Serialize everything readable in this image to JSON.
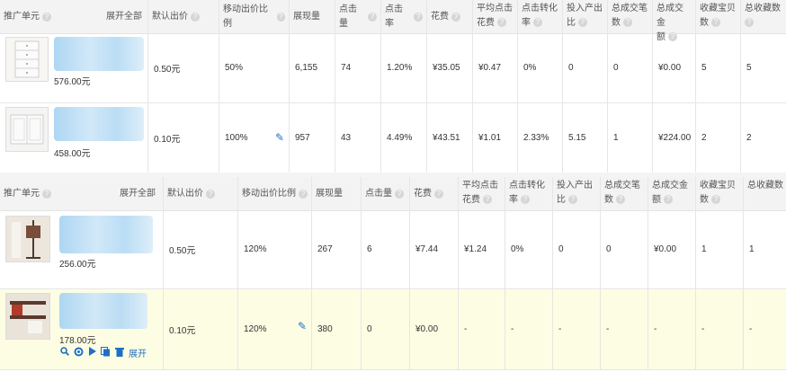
{
  "table1": {
    "headers": {
      "unit": "推广单元",
      "expand": "展开全部",
      "bid": "默认出价",
      "mobile_ratio": "移动出价比例",
      "impressions": "展现量",
      "clicks": "点击量",
      "ctr": "点击率",
      "cost": "花费",
      "avg_cpc_1": "平均点击",
      "avg_cpc_2": "花费",
      "conv_1": "点击转化",
      "conv_2": "率",
      "roi_1": "投入产出",
      "roi_2": "比",
      "orders_1": "总成交笔",
      "orders_2": "数",
      "amount_1": "总成交金",
      "amount_2": "额",
      "fav_items_1": "收藏宝贝",
      "fav_items_2": "数",
      "fav_shop_1": "总收藏数"
    },
    "rows": [
      {
        "price": "576.00元",
        "bid": "0.50元",
        "mobile_ratio": "50%",
        "impressions": "6,155",
        "clicks": "74",
        "ctr": "1.20%",
        "cost": "¥35.05",
        "avg_cpc": "¥0.47",
        "conv": "0%",
        "roi": "0",
        "orders": "0",
        "amount": "¥0.00",
        "fav_items": "5",
        "fav_total": "5"
      },
      {
        "price": "458.00元",
        "bid": "0.10元",
        "mobile_ratio": "100%",
        "impressions": "957",
        "clicks": "43",
        "ctr": "4.49%",
        "cost": "¥43.51",
        "avg_cpc": "¥1.01",
        "conv": "2.33%",
        "roi": "5.15",
        "orders": "1",
        "amount": "¥224.00",
        "fav_items": "2",
        "fav_total": "2"
      }
    ]
  },
  "table2": {
    "headers": {
      "unit": "推广单元",
      "expand": "展开全部",
      "bid": "默认出价",
      "mobile_ratio": "移动出价比例",
      "impressions": "展现量",
      "clicks": "点击量",
      "cost": "花费",
      "avg_cpc_1": "平均点击",
      "avg_cpc_2": "花费",
      "conv_1": "点击转化",
      "conv_2": "率",
      "roi_1": "投入产出",
      "roi_2": "比",
      "orders_1": "总成交笔",
      "orders_2": "数",
      "amount_1": "总成交金",
      "amount_2": "额",
      "fav_items_1": "收藏宝贝",
      "fav_items_2": "数",
      "fav_total_1": "总收藏数"
    },
    "rows": [
      {
        "price": "256.00元",
        "bid": "0.50元",
        "mobile_ratio": "120%",
        "impressions": "267",
        "clicks": "6",
        "cost": "¥7.44",
        "avg_cpc": "¥1.24",
        "conv": "0%",
        "roi": "0",
        "orders": "0",
        "amount": "¥0.00",
        "fav_items": "1",
        "fav_total": "1"
      },
      {
        "price": "178.00元",
        "bid": "0.10元",
        "mobile_ratio": "120%",
        "impressions": "380",
        "clicks": "0",
        "cost": "¥0.00",
        "avg_cpc": "-",
        "conv": "-",
        "roi": "-",
        "orders": "-",
        "amount": "-",
        "fav_items": "-",
        "fav_total": "-",
        "expand_link": "展开"
      }
    ]
  },
  "help_glyph": "?",
  "icons": {
    "edit": "pencil-icon",
    "search": "search-icon",
    "target": "target-icon",
    "play": "play-icon",
    "copy": "copy-icon",
    "delete": "trash-icon"
  },
  "colors": {
    "link": "#1f6fc4",
    "highlight_row": "#fcfde3",
    "header_bg": "#f3f3f3"
  }
}
